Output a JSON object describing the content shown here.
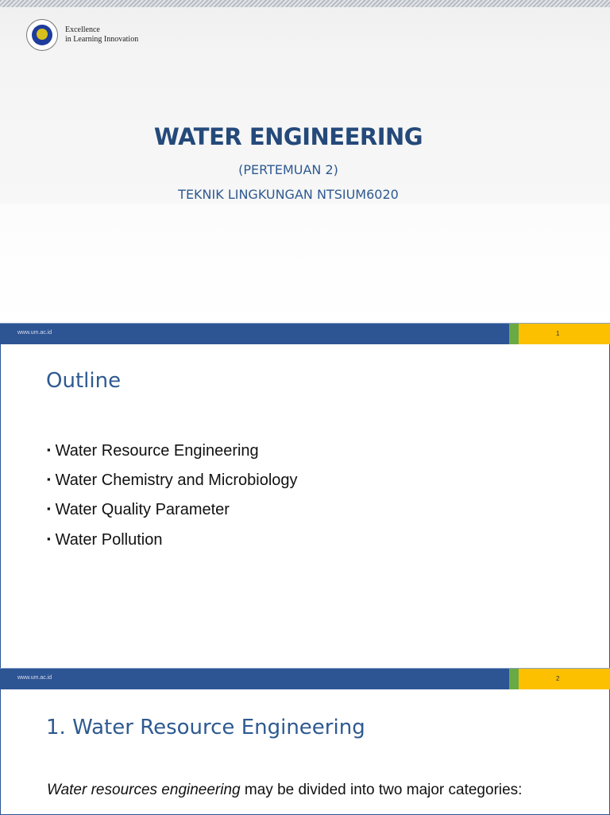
{
  "slide1": {
    "tagline_line1": "Excellence",
    "tagline_line2": "in Learning Innovation",
    "title": "WATER ENGINEERING",
    "subtitle1": "(PERTEMUAN 2)",
    "subtitle2": "TEKNIK LINGKUNGAN NTSIUM6020"
  },
  "footer1": {
    "url": "www.um.ac.id",
    "page": "1"
  },
  "slide2": {
    "title": "Outline",
    "bullets": [
      "Water Resource Engineering",
      "Water Chemistry and Microbiology",
      "Water Quality Parameter",
      "Water Pollution"
    ]
  },
  "footer2": {
    "url": "www.um.ac.id",
    "page": "2"
  },
  "slide3": {
    "title": "1. Water Resource Engineering",
    "para_italic": "Water resources engineering",
    "para_rest": " may be divided into two major categories:"
  }
}
